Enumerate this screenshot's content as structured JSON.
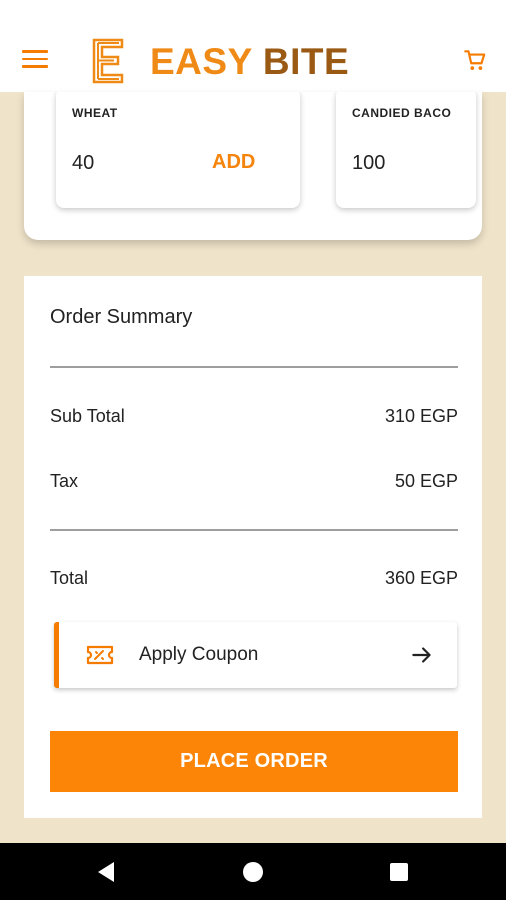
{
  "header": {
    "brand_part1": "EASY",
    "brand_part2": "BITE",
    "menu_icon": "hamburger-menu-icon",
    "cart_icon": "shopping-cart-icon",
    "logo_icon": "easy-bite-logo-icon"
  },
  "products": [
    {
      "name": "WHEAT",
      "price": "40",
      "action": "ADD"
    },
    {
      "name": "CANDIED BACO",
      "price": "100"
    }
  ],
  "summary": {
    "title": "Order Summary",
    "rows": [
      {
        "label": "Sub Total",
        "value": "310 EGP"
      },
      {
        "label": "Tax",
        "value": "50 EGP"
      }
    ],
    "total": {
      "label": "Total",
      "value": "360 EGP"
    },
    "coupon": {
      "label": "Apply Coupon",
      "icon": "ticket-icon",
      "arrow": "arrow-right-icon"
    },
    "place_order_label": "PLACE ORDER"
  },
  "colors": {
    "accent": "#f57c00",
    "button": "#fc8508",
    "background": "#efe3c9",
    "brand_dark": "#9a5a14"
  },
  "navbar": {
    "back_icon": "nav-back-icon",
    "home_icon": "nav-home-icon",
    "recents_icon": "nav-recents-icon"
  }
}
